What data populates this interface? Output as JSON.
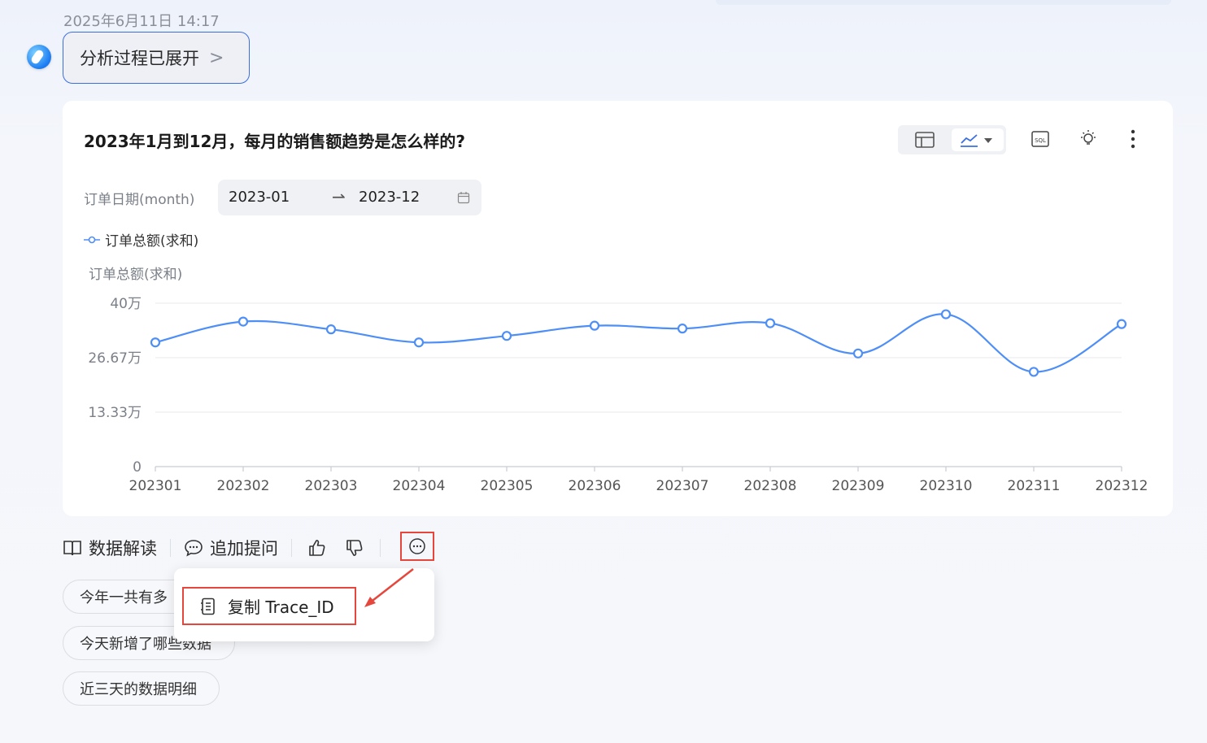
{
  "timestamp": "2025年6月11日 14:17",
  "analysis_button": {
    "label": "分析过程已展开",
    "chevron": ">"
  },
  "card": {
    "title": "2023年1月到12月，每月的销售额趋势是怎么样的?",
    "toolbar": {
      "table_icon": "table-icon",
      "chart_icon": "line-chart-icon",
      "sql_icon": "sql-icon",
      "bulb_icon": "bulb-icon",
      "more_icon": "more-vertical-icon"
    },
    "filter": {
      "label": "订单日期(month)",
      "start": "2023-01",
      "arrow": "⇀",
      "end": "2023-12"
    }
  },
  "chart_data": {
    "type": "line",
    "legend": [
      "订单总额(求和)"
    ],
    "ylabel": "订单总额(求和)",
    "categories": [
      "202301",
      "202302",
      "202303",
      "202304",
      "202305",
      "202306",
      "202307",
      "202308",
      "202309",
      "202310",
      "202311",
      "202312"
    ],
    "series": [
      {
        "name": "订单总额(求和)",
        "values": [
          304000,
          355000,
          336000,
          304000,
          320000,
          345000,
          338000,
          351000,
          277000,
          373000,
          232000,
          349000
        ]
      }
    ],
    "yticks": [
      {
        "value": 400000,
        "label": "40万"
      },
      {
        "value": 266667,
        "label": "26.67万"
      },
      {
        "value": 133333,
        "label": "13.33万"
      },
      {
        "value": 0,
        "label": "0"
      }
    ],
    "ylim": [
      0,
      400000
    ],
    "grid": true,
    "color": "#4e8ef7"
  },
  "actions": {
    "interpret": "数据解读",
    "followup": "追加提问",
    "like_icon": "thumbs-up-icon",
    "dislike_icon": "thumbs-down-icon",
    "more_icon": "more-horizontal-icon"
  },
  "suggestions": [
    "今年一共有多",
    "今天新增了哪些数据",
    "近三天的数据明细"
  ],
  "popup": {
    "copy_label": "复制 Trace_ID"
  },
  "colors": {
    "accent": "#3b6fe0",
    "highlight": "#e5473d"
  }
}
